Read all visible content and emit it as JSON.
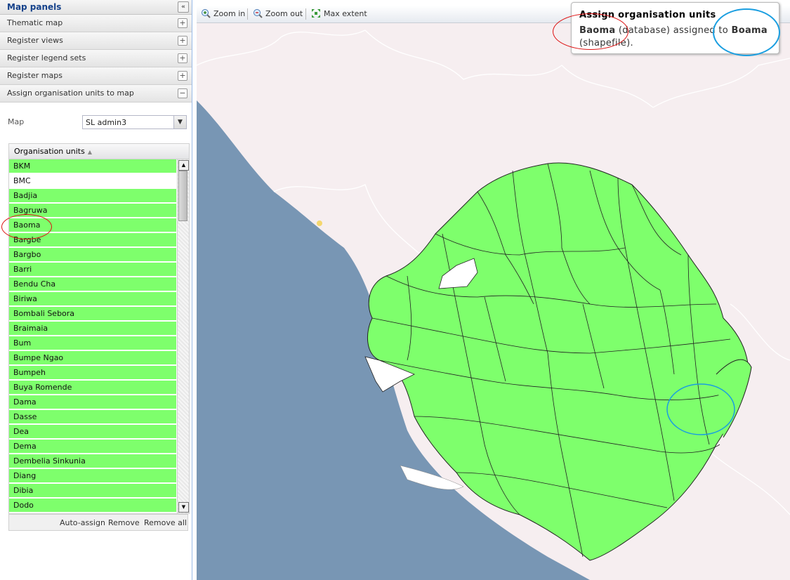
{
  "left_panel": {
    "title": "Map panels",
    "accordion": [
      {
        "label": "Thematic map",
        "state": "+"
      },
      {
        "label": "Register views",
        "state": "+"
      },
      {
        "label": "Register legend sets",
        "state": "+"
      },
      {
        "label": "Register maps",
        "state": "+"
      },
      {
        "label": "Assign organisation units to map",
        "state": "−"
      }
    ],
    "map_label": "Map",
    "map_value": "SL admin3",
    "grid_header": "Organisation units",
    "org_units": [
      "BKM",
      "BMC",
      "Badjia",
      "Bagruwa",
      "Baoma",
      "Bargbe",
      "Bargbo",
      "Barri",
      "Bendu Cha",
      "Biriwa",
      "Bombali Sebora",
      "Braimaia",
      "Bum",
      "Bumpe Ngao",
      "Bumpeh",
      "Buya Romende",
      "Dama",
      "Dasse",
      "Dea",
      "Dema",
      "Dembelia Sinkunia",
      "Diang",
      "Dibia",
      "Dodo"
    ],
    "unassigned": [
      "BMC"
    ],
    "footer": {
      "auto_assign": "Auto-assign",
      "remove": "Remove",
      "remove_all": "Remove all"
    }
  },
  "toolbar": {
    "zoom_in": "Zoom in",
    "zoom_out": "Zoom out",
    "max_extent": "Max extent"
  },
  "tooltip": {
    "title": "Assign organisation units",
    "name_db": "Baoma",
    "mid": " (database) assigned to ",
    "name_shp": "Boama",
    "end": "(shapefile)."
  },
  "colors": {
    "assigned": "#7eff6c",
    "sea": "#7896b4",
    "land": "#f6eef0",
    "highlight_red": "#d11",
    "highlight_blue": "#1a9ee0"
  }
}
